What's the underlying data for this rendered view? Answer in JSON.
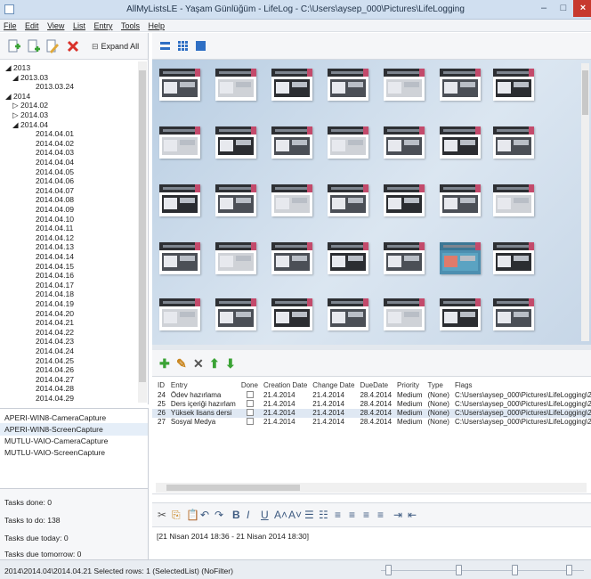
{
  "window": {
    "title": "AllMyListsLE - Yaşam Günlüğüm - LifeLog - C:\\Users\\aysep_000\\Pictures\\LifeLogging",
    "min_glyph": "–",
    "max_glyph": "□",
    "close_glyph": "×"
  },
  "menu": [
    "File",
    "Edit",
    "View",
    "List",
    "Entry",
    "Tools",
    "Help"
  ],
  "toolbar": {
    "expand_all": "Expand All"
  },
  "tree": {
    "items": [
      {
        "label": "◢ 2013",
        "level": 0
      },
      {
        "label": "◢ 2013.03",
        "level": 1
      },
      {
        "label": "2013.03.24",
        "level": 2
      },
      {
        "label": "◢ 2014",
        "level": 0
      },
      {
        "label": "▷ 2014.02",
        "level": 1
      },
      {
        "label": "▷ 2014.03",
        "level": 1
      },
      {
        "label": "◢ 2014.04",
        "level": 1
      },
      {
        "label": "2014.04.01",
        "level": 2
      },
      {
        "label": "2014.04.02",
        "level": 2
      },
      {
        "label": "2014.04.03",
        "level": 2
      },
      {
        "label": "2014.04.04",
        "level": 2
      },
      {
        "label": "2014.04.05",
        "level": 2
      },
      {
        "label": "2014.04.06",
        "level": 2
      },
      {
        "label": "2014.04.07",
        "level": 2
      },
      {
        "label": "2014.04.08",
        "level": 2
      },
      {
        "label": "2014.04.09",
        "level": 2
      },
      {
        "label": "2014.04.10",
        "level": 2
      },
      {
        "label": "2014.04.11",
        "level": 2
      },
      {
        "label": "2014.04.12",
        "level": 2
      },
      {
        "label": "2014.04.13",
        "level": 2
      },
      {
        "label": "2014.04.14",
        "level": 2
      },
      {
        "label": "2014.04.15",
        "level": 2
      },
      {
        "label": "2014.04.16",
        "level": 2
      },
      {
        "label": "2014.04.17",
        "level": 2
      },
      {
        "label": "2014.04.18",
        "level": 2
      },
      {
        "label": "2014.04.19",
        "level": 2
      },
      {
        "label": "2014.04.20",
        "level": 2
      },
      {
        "label": "2014.04.21",
        "level": 2
      },
      {
        "label": "2014.04.22",
        "level": 2
      },
      {
        "label": "2014.04.23",
        "level": 2
      },
      {
        "label": "2014.04.24",
        "level": 2
      },
      {
        "label": "2014.04.25",
        "level": 2
      },
      {
        "label": "2014.04.26",
        "level": 2
      },
      {
        "label": "2014.04.27",
        "level": 2
      },
      {
        "label": "2014.04.28",
        "level": 2
      },
      {
        "label": "2014.04.29",
        "level": 2
      }
    ]
  },
  "captures": [
    {
      "label": "APERI-WIN8-CameraCapture",
      "selected": false
    },
    {
      "label": "APERI-WIN8-ScreenCapture",
      "selected": true
    },
    {
      "label": "MUTLU-VAIO-CameraCapture",
      "selected": false
    },
    {
      "label": "MUTLU-VAIO-ScreenCapture",
      "selected": false
    }
  ],
  "stats": [
    "Tasks done: 0",
    "Tasks to do: 138",
    "Tasks due today: 0",
    "Tasks due tomorrow: 0"
  ],
  "entries": {
    "columns": [
      "ID",
      "Entry",
      "Done",
      "Creation Date",
      "Change Date",
      "DueDate",
      "Priority",
      "Type",
      "Flags"
    ],
    "rows": [
      {
        "id": "24",
        "entry": "Ödev hazırlama",
        "creation": "21.4.2014",
        "change": "21.4.2014",
        "due": "28.4.2014",
        "priority": "Medium",
        "type": "(None)",
        "flags": "C:\\Users\\aysep_000\\Pictures\\LifeLogging\\2014\\2",
        "selected": false
      },
      {
        "id": "25",
        "entry": "Ders içeriği hazırlam",
        "creation": "21.4.2014",
        "change": "21.4.2014",
        "due": "28.4.2014",
        "priority": "Medium",
        "type": "(None)",
        "flags": "C:\\Users\\aysep_000\\Pictures\\LifeLogging\\2014\\2",
        "selected": false
      },
      {
        "id": "26",
        "entry": "Yüksek lisans dersi",
        "creation": "21.4.2014",
        "change": "21.4.2014",
        "due": "28.4.2014",
        "priority": "Medium",
        "type": "(None)",
        "flags": "C:\\Users\\aysep_000\\Pictures\\LifeLogging\\2014\\2",
        "selected": true
      },
      {
        "id": "27",
        "entry": "Sosyal Medya",
        "creation": "21.4.2014",
        "change": "21.4.2014",
        "due": "28.4.2014",
        "priority": "Medium",
        "type": "(None)",
        "flags": "C:\\Users\\aysep_000\\Pictures\\LifeLogging\\2014\\2",
        "selected": false
      }
    ]
  },
  "editor": {
    "content": "[21 Nisan 2014 18:36 - 21 Nisan 2014 18:30]"
  },
  "status": {
    "text": "2014\\2014.04\\2014.04.21   Selected rows: 1   (SelectedList)   (NoFilter)"
  },
  "colors": {
    "accent_green": "#3aa335",
    "delete_red": "#d9312a",
    "view_blue": "#2f6fc4",
    "gallery_bg": "#c6d6e7"
  },
  "icons": {
    "entry_toolbar": [
      "add-icon",
      "edit-icon",
      "delete-icon",
      "move-up-icon",
      "move-down-icon"
    ],
    "format_toolbar": [
      "cut-icon",
      "copy-icon",
      "paste-icon",
      "undo-icon",
      "redo-icon",
      "bold-icon",
      "italic-icon",
      "underline-icon",
      "grow-font-icon",
      "shrink-font-icon",
      "bullets-icon",
      "numbering-icon",
      "align-left-icon",
      "align-center-icon",
      "align-right-icon",
      "justify-icon",
      "indent-icon",
      "outdent-icon"
    ]
  },
  "format_glyphs": [
    "✂",
    "⎘",
    "📋",
    "↶",
    "↷",
    "B",
    "I",
    "U",
    "A˄",
    "A˅",
    "☰",
    "☷",
    "≡",
    "≡",
    "≡",
    "≡",
    "⇥",
    "⇤"
  ]
}
